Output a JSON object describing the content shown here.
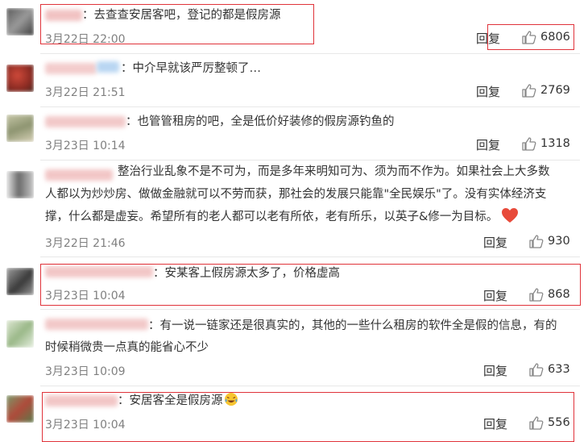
{
  "colors": {
    "highlight": "#e0333a",
    "time": "#808080",
    "divider": "#e8e8e8"
  },
  "reply_label": "回复",
  "comments": [
    {
      "text": "：去查查安居客吧，登记的都是假房源",
      "time": "3月22日 22:00",
      "likes": "6806"
    },
    {
      "text": "：中介早就该严厉整顿了…",
      "time": "3月22日 21:51",
      "likes": "2769"
    },
    {
      "text": "：也管管租房的吧，全是低价好装修的假房源钓鱼的",
      "time": "3月23日 10:14",
      "likes": "1318"
    },
    {
      "text_line1": "整治行业乱象不是不可为，而是多年来明知可为、须为而不作为。如果社会上大多数",
      "text_line2": "人都以为炒炒房、做做金融就可以不劳而获，那社会的发展只能靠\"全民娱乐\"了。没有实体经济支",
      "text_line3": "撑，什么都是虚妄。希望所有的老人都可以老有所依，老有所乐，以英子&修一为目标。",
      "time": "3月22日 21:46",
      "likes": "930",
      "emoji": "heart-icon"
    },
    {
      "text": "：安某客上假房源太多了，价格虚高",
      "time": "3月23日 10:04",
      "likes": "868"
    },
    {
      "text_line1": "：有一说一链家还是很真实的，其他的一些什么租房的软件全是假的信息，有的",
      "text_line2": "时候稍微贵一点真的能省心不少",
      "time": "3月23日 10:09",
      "likes": "633"
    },
    {
      "text": "：安居客全是假房源",
      "time": "3月23日 10:04",
      "likes": "556",
      "emoji": "laughing-crying-icon"
    }
  ]
}
